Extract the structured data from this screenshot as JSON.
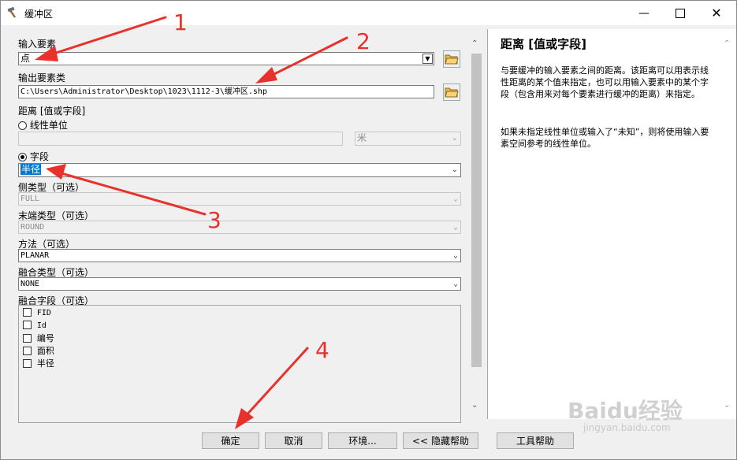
{
  "window": {
    "title": "缓冲区"
  },
  "form": {
    "input_label": "输入要素",
    "input_value": "点",
    "output_label": "输出要素类",
    "output_value": "C:\\Users\\Administrator\\Desktop\\1023\\1112-3\\缓冲区.shp",
    "distance_label": "距离 [值或字段]",
    "linear_label": "线性单位",
    "unit_value": "米",
    "field_label": "字段",
    "field_value": "半径",
    "side_label": "侧类型（可选）",
    "side_value": "FULL",
    "end_label": "末端类型（可选）",
    "end_value": "ROUND",
    "method_label": "方法（可选）",
    "method_value": "PLANAR",
    "dissolve_label": "融合类型（可选）",
    "dissolve_value": "NONE",
    "dissolve_field_label": "融合字段（可选）",
    "dissolve_fields": [
      "FID",
      "Id",
      "编号",
      "面积",
      "半径"
    ]
  },
  "help": {
    "title": "距离 [值或字段]",
    "para1": "与要缓冲的输入要素之间的距离。该距离可以用表示线性距离的某个值来指定，也可以用输入要素中的某个字段（包含用来对每个要素进行缓冲的距离）来指定。",
    "para2": "如果未指定线性单位或输入了“未知”，则将使用输入要素空间参考的线性单位。"
  },
  "buttons": {
    "ok": "确定",
    "cancel": "取消",
    "env": "环境...",
    "hide_help": "<< 隐藏帮助",
    "tool_help": "工具帮助"
  },
  "annotations": [
    "1",
    "2",
    "3",
    "4"
  ],
  "watermark": {
    "brand": "Baidu经验",
    "url": "jingyan.baidu.com"
  },
  "colors": {
    "arrow": "#e8312a",
    "selection": "#0078d7"
  }
}
